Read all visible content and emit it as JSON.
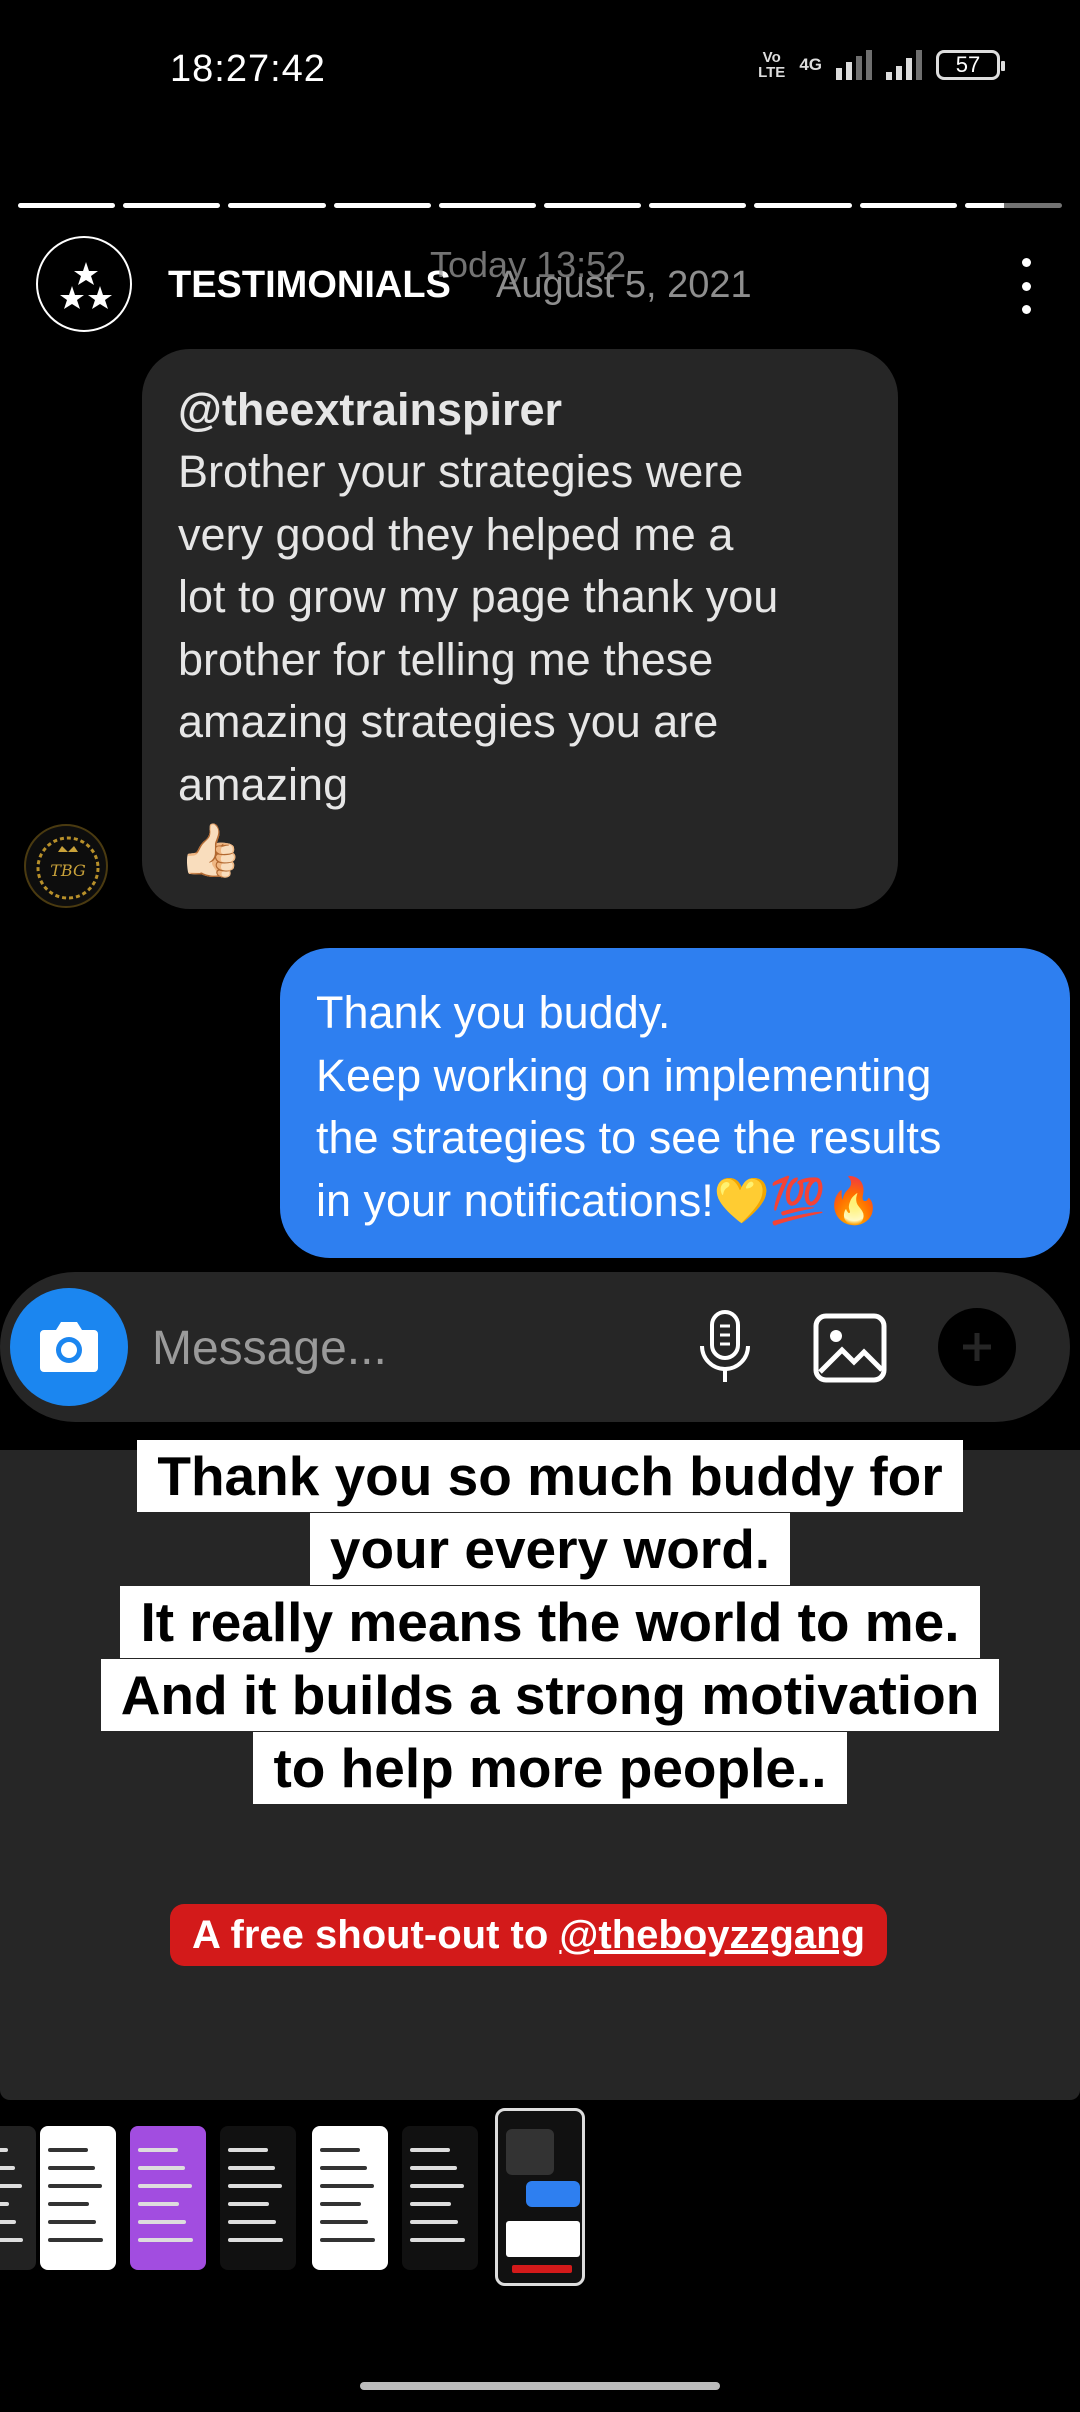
{
  "status_bar": {
    "time": "18:27:42",
    "volte_top": "Vo",
    "volte_mid": "LTE",
    "network": "4G",
    "battery": "57"
  },
  "story": {
    "progress_total": 10,
    "progress_current": 10,
    "username": "TESTIMONIALS",
    "overlay_time": "Today 13:52",
    "date": "August 5, 2021",
    "accent_blue": "#2e7ff0",
    "shoutout_red": "#d31a1a"
  },
  "chat": {
    "incoming": {
      "handle": "@theextrainspirer",
      "lines": [
        "Brother your strategies were",
        "very good they helped me a",
        "lot to grow my page thank you",
        "brother for telling me these",
        "amazing strategies you are",
        "amazing"
      ],
      "emoji": "👍🏻"
    },
    "outgoing": {
      "lines": [
        "Thank you buddy.",
        "Keep working on implementing",
        "the strategies to see the results",
        "in your notifications!💛💯🔥"
      ]
    },
    "composer": {
      "placeholder": "Message..."
    }
  },
  "caption": {
    "lines": [
      "Thank you so much buddy for",
      "your every word.",
      "It really means the world to me.",
      "And it builds a strong motivation",
      "to help more people.."
    ],
    "shoutout_prefix": "A free shout-out to ",
    "shoutout_mention": "@theboyzzgang"
  },
  "icons": {
    "avatar": "stars-logo-icon",
    "more": "more-vertical-icon",
    "camera": "camera-icon",
    "mic": "mic-icon",
    "gallery": "gallery-icon",
    "plus": "plus-icon"
  }
}
